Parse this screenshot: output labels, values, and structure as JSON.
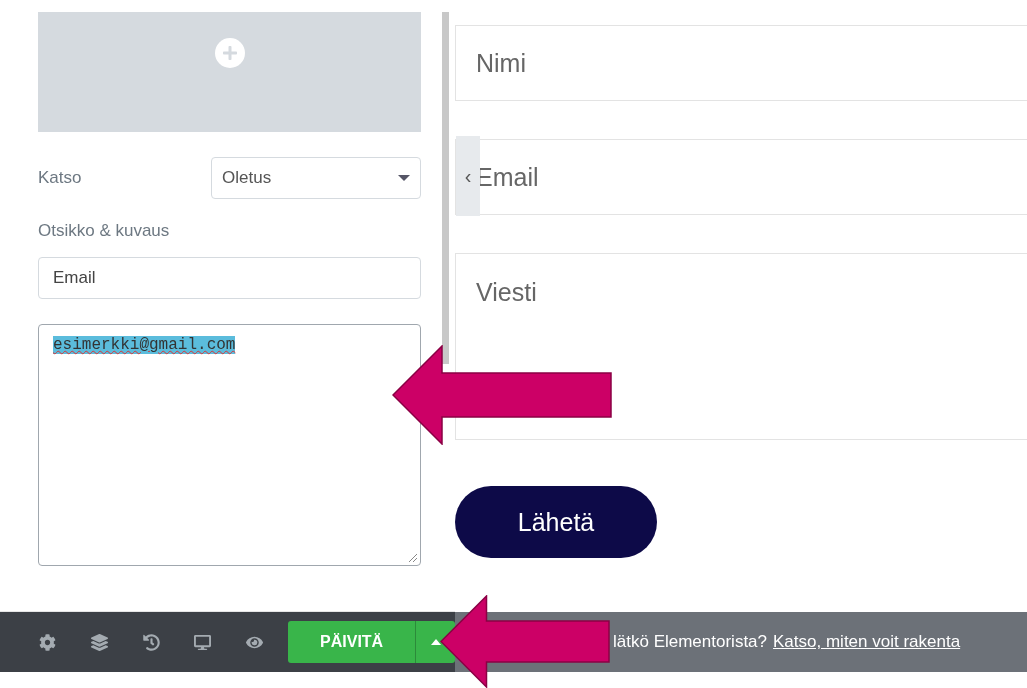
{
  "panel": {
    "view_label": "Katso",
    "view_value": "Oletus",
    "title_label": "Otsikko & kuvaus",
    "title_value": "Email",
    "description_value": "esimerkki@gmail.com",
    "description_selected": true
  },
  "preview": {
    "collapse_handle": "‹",
    "fields": [
      {
        "kind": "input",
        "placeholder": "Nimi"
      },
      {
        "kind": "input",
        "placeholder": "Email"
      },
      {
        "kind": "textarea",
        "placeholder": "Viesti"
      }
    ],
    "submit": "Lähetä"
  },
  "toolbar": {
    "update_button": "PÄIVITÄ",
    "notice": "lätkö Elementorista?",
    "notice_link": "Katso, miten voit rakenta"
  }
}
